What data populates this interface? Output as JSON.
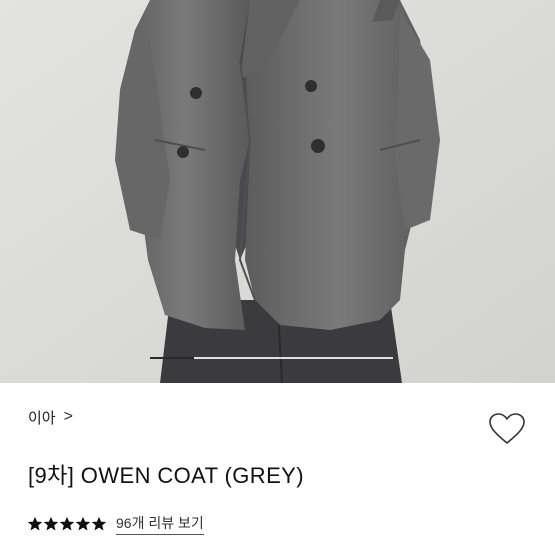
{
  "product": {
    "brand": "이아",
    "title": "[9차] OWEN COAT (GREY)",
    "rating": 5,
    "rating_max": 5,
    "review_link": "96개 리뷰 보기"
  },
  "carousel": {
    "progress_fraction": 0.18
  },
  "icons": {
    "brand_arrow": "chevron-right-icon",
    "favorite": "heart-outline-icon",
    "star": "star-filled-icon"
  },
  "colors": {
    "coat": "#6e6e6e",
    "background_photo": "#dcdcd9",
    "star": "#111111",
    "text": "#111111"
  }
}
